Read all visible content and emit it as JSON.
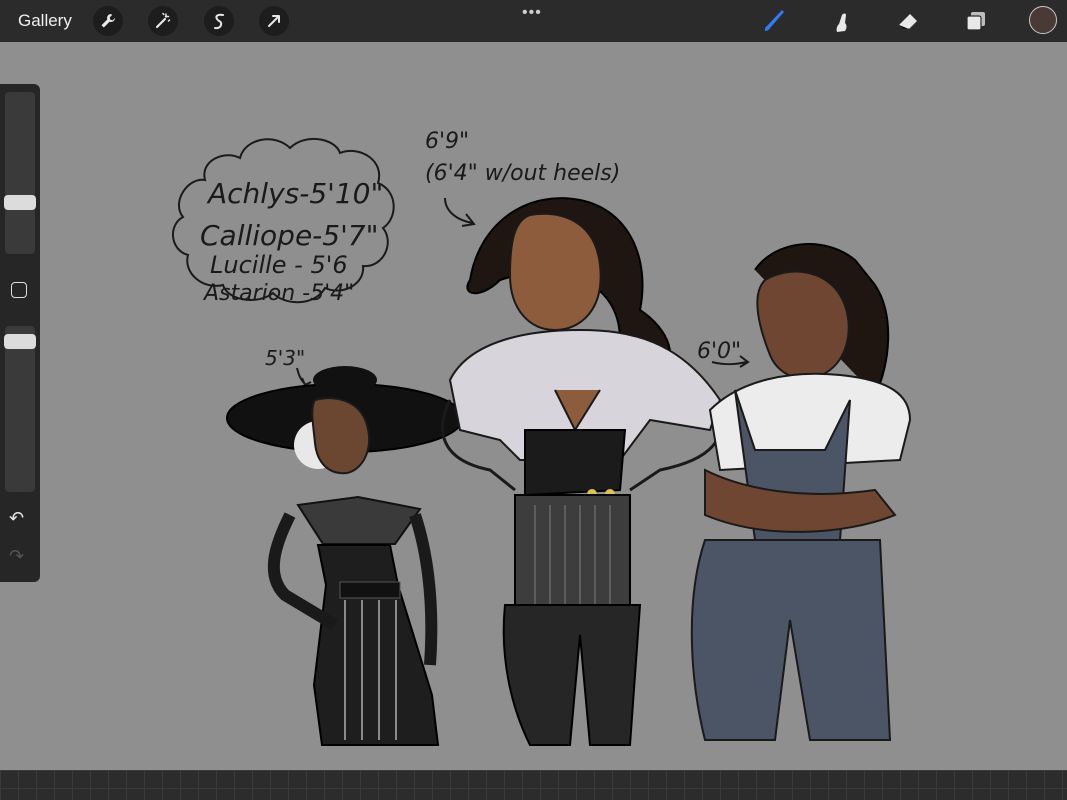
{
  "topbar": {
    "gallery_label": "Gallery",
    "left_tools": [
      "wrench-icon",
      "magic-wand-icon",
      "selection-icon",
      "transform-arrow-icon"
    ],
    "more_label": "•••",
    "right_tools": [
      "brush-icon",
      "smudge-icon",
      "eraser-icon",
      "layers-icon"
    ],
    "accent_color": "#2f7cf6",
    "current_color": "#4a3a35"
  },
  "sidebar": {
    "brush_size_level": 0.3,
    "opacity_level": 0.1,
    "undo_label": "↶",
    "redo_label": "↷"
  },
  "artwork": {
    "height_notes": [
      "Achlys-5'10\"",
      "Calliope-5'7\"",
      "Lucille - 5'6",
      "Astarion -5'4\""
    ],
    "tall_label_line1": "6'9\"",
    "tall_label_line2": "(6'4\" w/out heels)",
    "short_label": "5'3\"",
    "right_label": "6'0\""
  }
}
